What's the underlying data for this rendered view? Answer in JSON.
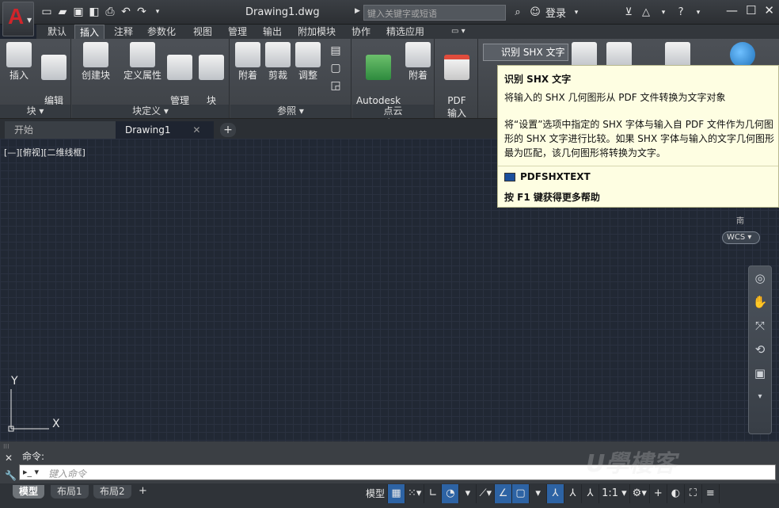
{
  "titlebar": {
    "app_logo": "A",
    "quick_access_icons": [
      "new-icon",
      "open-icon",
      "save-icon",
      "save-as-icon",
      "print-icon",
      "undo-icon",
      "redo-icon",
      "dropdown-icon"
    ],
    "document_title": "Drawing1.dwg",
    "search_placeholder": "键入关键字或短语",
    "login_label": "登录",
    "help_label": "?"
  },
  "ribbon_tabs": [
    {
      "label": "默认"
    },
    {
      "label": "插入"
    },
    {
      "label": "注释"
    },
    {
      "label": "参数化"
    },
    {
      "label": "视图"
    },
    {
      "label": "管理"
    },
    {
      "label": "输出"
    },
    {
      "label": "附加模块"
    },
    {
      "label": "协作"
    },
    {
      "label": "精选应用"
    }
  ],
  "active_tab": "插入",
  "panels": {
    "block": {
      "title": "块 ▾",
      "insert": "插入",
      "edit_attr": "编辑\n属性"
    },
    "block_def": {
      "title": "块定义 ▾",
      "create": "创建块",
      "define_attr": "定义属性",
      "manage_attr": "管理\n属性",
      "block_editor": "块\n编辑器"
    },
    "reference": {
      "title": "参照 ▾",
      "attach": "附着",
      "clip": "剪裁",
      "adjust": "调整"
    },
    "pointcloud": {
      "title": "点云",
      "recap": "Autodesk\nReCap",
      "attach": "附着"
    },
    "import": {
      "pdf": "PDF\n输入",
      "shx_button": "识别 SHX 文字"
    }
  },
  "file_tabs": [
    {
      "label": "开始"
    },
    {
      "label": "Drawing1",
      "close": "✕"
    }
  ],
  "viewport_label": "[—][俯视][二维线框]",
  "ucs": {
    "y": "Y",
    "x": "X"
  },
  "tooltip": {
    "title": "识别 SHX 文字",
    "description": "将输入的 SHX 几何图形从 PDF 文件转换为文字对象",
    "body": "将“设置”选项中指定的 SHX 字体与输入自 PDF 文件作为几何图形的 SHX 文字进行比较。如果 SHX 字体与输入的文字几何图形最为匹配，该几何图形将转换为文字。",
    "command": "PDFSHXTEXT",
    "help": "按 F1 键获得更多帮助"
  },
  "viewcube": {
    "south": "南",
    "wcs": "WCS ▾"
  },
  "command": {
    "history": "命令:",
    "placeholder": "键入命令"
  },
  "layout_tabs": [
    {
      "label": "模型"
    },
    {
      "label": "布局1"
    },
    {
      "label": "布局2"
    }
  ],
  "status": {
    "model": "模型",
    "scale": "1:1 ▾"
  },
  "watermark": "U學樓客"
}
